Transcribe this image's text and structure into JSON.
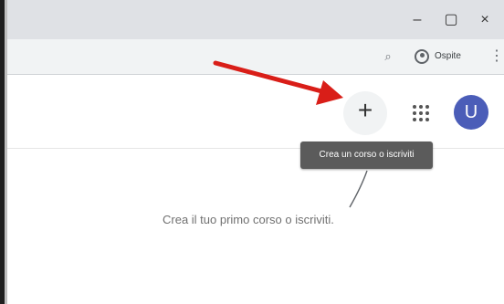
{
  "window_controls": {
    "minimize": "–",
    "restore": "▢",
    "close": "×"
  },
  "browser_toolbar": {
    "zoom_icon": "zoom-icon",
    "guest_label": "Ospite",
    "menu": "⋮"
  },
  "classroom_header": {
    "add_button": "+",
    "apps_icon": "apps-grid-icon",
    "avatar_initial": "U"
  },
  "tooltip": {
    "text": "Crea un corso o iscriviti"
  },
  "main": {
    "empty_state_message": "Crea il tuo primo corso o iscriviti."
  },
  "colors": {
    "title_bar": "#dfe1e5",
    "address_bar": "#f1f3f4",
    "avatar": "#4b5db8",
    "tooltip": "#5b5b5b",
    "arrow": "#d91e18"
  }
}
